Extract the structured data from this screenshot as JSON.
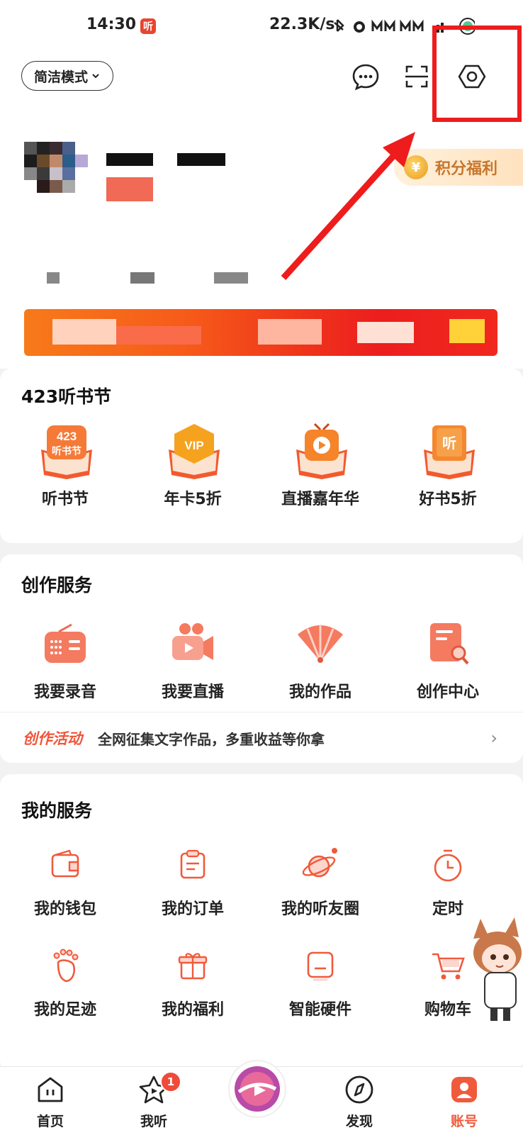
{
  "status_bar": {
    "time": "14:30",
    "app_badge": "听",
    "network_speed": "22.3K/s"
  },
  "header": {
    "mode_label": "简洁模式"
  },
  "points": {
    "label": "积分福利"
  },
  "festival": {
    "title": "423听书节",
    "items": [
      {
        "label": "听书节",
        "art": "423\n听书节"
      },
      {
        "label": "年卡5折",
        "art": "VIP"
      },
      {
        "label": "直播嘉年华",
        "art": ""
      },
      {
        "label": "好书5折",
        "art": "听"
      }
    ]
  },
  "creation": {
    "title": "创作服务",
    "items": [
      {
        "label": "我要录音"
      },
      {
        "label": "我要直播"
      },
      {
        "label": "我的作品"
      },
      {
        "label": "创作中心"
      }
    ],
    "promo_tag": "创作活动",
    "promo_text": "全网征集文字作品，多重收益等你拿"
  },
  "services": {
    "title": "我的服务",
    "items": [
      {
        "label": "我的钱包",
        "icon": "wallet-icon"
      },
      {
        "label": "我的订单",
        "icon": "order-icon"
      },
      {
        "label": "我的听友圈",
        "icon": "planet-icon"
      },
      {
        "label": "定时",
        "icon": "timer-icon"
      },
      {
        "label": "我的足迹",
        "icon": "footprint-icon"
      },
      {
        "label": "我的福利",
        "icon": "gift-icon"
      },
      {
        "label": "智能硬件",
        "icon": "device-icon"
      },
      {
        "label": "购物车",
        "icon": "cart-icon"
      }
    ]
  },
  "tabbar": {
    "items": [
      {
        "label": "首页",
        "icon": "home-icon"
      },
      {
        "label": "我听",
        "icon": "star-play-icon",
        "badge": "1"
      },
      {
        "label": "",
        "icon": "center-disc-icon"
      },
      {
        "label": "发现",
        "icon": "discover-icon"
      },
      {
        "label": "账号",
        "icon": "account-icon"
      }
    ]
  },
  "colors": {
    "accent": "#f05a3c",
    "highlight": "#ee1c1c",
    "points_text": "#c7772d"
  }
}
